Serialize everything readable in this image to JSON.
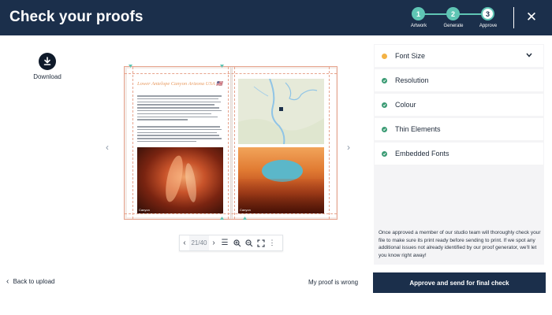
{
  "header": {
    "title": "Check your proofs",
    "steps": [
      {
        "number": "1",
        "label": "Artwork",
        "state": "done"
      },
      {
        "number": "2",
        "label": "Generate",
        "state": "done"
      },
      {
        "number": "3",
        "label": "Approve",
        "state": "active"
      }
    ],
    "close_icon": "close-icon"
  },
  "download": {
    "label": "Download",
    "icon": "download-icon"
  },
  "preview": {
    "prev_icon": "chevron-left-icon",
    "next_icon": "chevron-right-icon",
    "left_page": {
      "title": "Lower Antelope Canyon Arizona USA 🇺🇸",
      "photo_caption": "Canyon"
    },
    "right_page": {
      "photo_caption": "Canyon"
    }
  },
  "toolbar": {
    "page_indicator": "21/40",
    "icons": [
      "chevron-left-icon",
      "chevron-right-icon",
      "menu-icon",
      "zoom-in-icon",
      "zoom-out-icon",
      "fullscreen-icon",
      "more-icon"
    ]
  },
  "checks": {
    "items": [
      {
        "label": "Font Size",
        "status": "warning",
        "expanded": false
      },
      {
        "label": "Resolution",
        "status": "ok"
      },
      {
        "label": "Colour",
        "status": "ok"
      },
      {
        "label": "Thin Elements",
        "status": "ok"
      },
      {
        "label": "Embedded Fonts",
        "status": "ok"
      }
    ],
    "note": "Once approved a member of our studio team will thoroughly check your file to make sure its print ready before sending to print. If we spot any additional issues not already identified by our proof generator, we'll let you know right away!"
  },
  "footer": {
    "back_label": "Back to upload",
    "wrong_label": "My proof is wrong",
    "approve_label": "Approve and send for final check"
  },
  "colors": {
    "header_bg": "#1b2f4b",
    "step_accent": "#5fc5b4",
    "warning": "#f3b245",
    "ok": "#3b9b74",
    "guide": "#e7a48e"
  }
}
